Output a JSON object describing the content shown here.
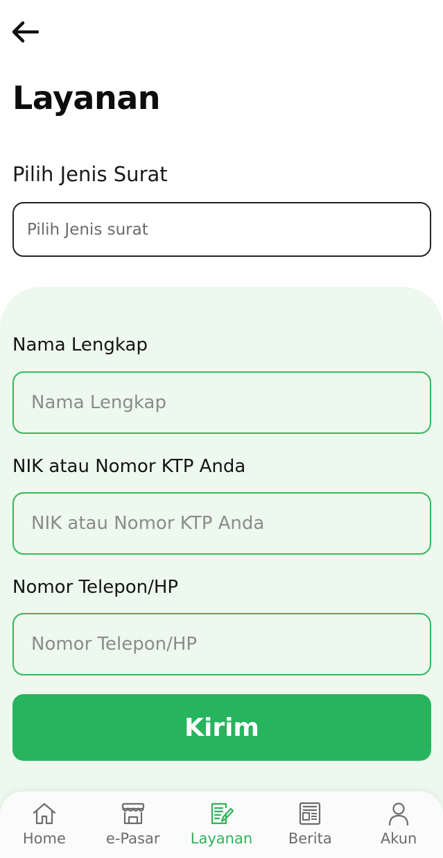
{
  "header": {
    "title": "Layanan"
  },
  "surat": {
    "label": "Pilih Jenis Surat",
    "placeholder": "Pilih Jenis surat"
  },
  "form": {
    "nama": {
      "label": "Nama Lengkap",
      "placeholder": "Nama Lengkap",
      "value": ""
    },
    "nik": {
      "label": "NIK atau Nomor KTP Anda",
      "placeholder": "NIK atau Nomor KTP Anda",
      "value": ""
    },
    "telepon": {
      "label": "Nomor Telepon/HP",
      "placeholder": "Nomor Telepon/HP",
      "value": ""
    },
    "submit_label": "Kirim"
  },
  "nav": {
    "items": [
      {
        "label": "Home",
        "icon": "home-icon",
        "active": false
      },
      {
        "label": "e-Pasar",
        "icon": "store-icon",
        "active": false
      },
      {
        "label": "Layanan",
        "icon": "document-edit-icon",
        "active": true
      },
      {
        "label": "Berita",
        "icon": "newspaper-icon",
        "active": false
      },
      {
        "label": "Akun",
        "icon": "user-icon",
        "active": false
      }
    ]
  },
  "colors": {
    "accent": "#27b45d",
    "panel_bg": "#edf8ee",
    "input_border": "#35b75b",
    "nav_inactive": "#6b6b6b"
  }
}
